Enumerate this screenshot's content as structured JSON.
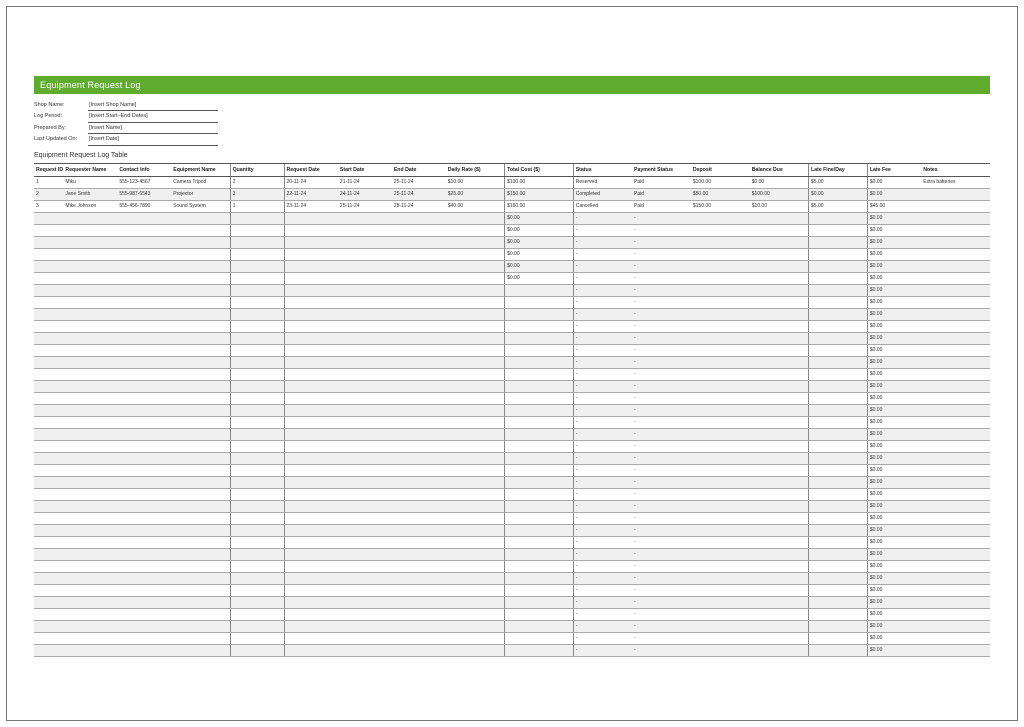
{
  "title": "Equipment Request Log",
  "meta": {
    "shop_name_label": "Shop Name:",
    "shop_name_value": "[Insert Shop Name]",
    "log_period_label": "Log Period:",
    "log_period_value": "[Insert Start–End Dates]",
    "prepared_by_label": "Prepared By:",
    "prepared_by_value": "[Insert Name]",
    "last_updated_label": "Last Updated On:",
    "last_updated_value": "[Insert Date]"
  },
  "subtitle": "Equipment Request Log Table",
  "columns": {
    "id": "Request ID",
    "requester": "Requester Name",
    "contact": "Contact Info",
    "equip": "Equipment Name",
    "qty": "Quantity",
    "rdate": "Request Date",
    "sdate": "Start Date",
    "edate": "End Date",
    "rate": "Daily Rate ($)",
    "total": "Total Cost ($)",
    "status": "Status",
    "paystat": "Payment Status",
    "deposit": "Deposit",
    "balance": "Balance Due",
    "lpd": "Late Fine/Day",
    "latefee": "Late Fee",
    "notes": "Notes"
  },
  "rows": [
    {
      "id": "1",
      "requester": "Miku",
      "contact": "555-123-4567",
      "equip": "Camera Tripod",
      "qty": "2",
      "rdate": "20-11-24",
      "sdate": "21-11-24",
      "edate": "25-11-24",
      "rate": "$10.00",
      "total": "$100.00",
      "status": "Reserved",
      "paystat": "Paid",
      "deposit": "$100.00",
      "balance": "$0.00",
      "lpd": "$5.00",
      "latefee": "$0.00",
      "notes": "Extra batteries"
    },
    {
      "id": "2",
      "requester": "Jane Smith",
      "contact": "555-987-6543",
      "equip": "Projector",
      "qty": "3",
      "rdate": "22-11-24",
      "sdate": "24-11-24",
      "edate": "25-11-24",
      "rate": "$25.00",
      "total": "$150.00",
      "status": "Completed",
      "paystat": "Paid",
      "deposit": "$50.00",
      "balance": "$100.00",
      "lpd": "$0.00",
      "latefee": "$0.00",
      "notes": ""
    },
    {
      "id": "3",
      "requester": "Mike Johnson",
      "contact": "555-456-7890",
      "equip": "Sound System",
      "qty": "1",
      "rdate": "23-11-24",
      "sdate": "25-11-24",
      "edate": "28-11-24",
      "rate": "$40.00",
      "total": "$160.00",
      "status": "Cancelled",
      "paystat": "Paid",
      "deposit": "$150.00",
      "balance": "$10.00",
      "lpd": "$5.00",
      "latefee": "$45.00",
      "notes": ""
    },
    {
      "id": "",
      "requester": "",
      "contact": "",
      "equip": "",
      "qty": "",
      "rdate": "",
      "sdate": "",
      "edate": "",
      "rate": "",
      "total": "$0.00",
      "status": "-",
      "paystat": "-",
      "deposit": "",
      "balance": "",
      "lpd": "",
      "latefee": "$0.00",
      "notes": ""
    },
    {
      "id": "",
      "requester": "",
      "contact": "",
      "equip": "",
      "qty": "",
      "rdate": "",
      "sdate": "",
      "edate": "",
      "rate": "",
      "total": "$0.00",
      "status": "-",
      "paystat": "-",
      "deposit": "",
      "balance": "",
      "lpd": "",
      "latefee": "$0.00",
      "notes": ""
    },
    {
      "id": "",
      "requester": "",
      "contact": "",
      "equip": "",
      "qty": "",
      "rdate": "",
      "sdate": "",
      "edate": "",
      "rate": "",
      "total": "$0.00",
      "status": "-",
      "paystat": "-",
      "deposit": "",
      "balance": "",
      "lpd": "",
      "latefee": "$0.00",
      "notes": ""
    },
    {
      "id": "",
      "requester": "",
      "contact": "",
      "equip": "",
      "qty": "",
      "rdate": "",
      "sdate": "",
      "edate": "",
      "rate": "",
      "total": "$0.00",
      "status": "-",
      "paystat": "-",
      "deposit": "",
      "balance": "",
      "lpd": "",
      "latefee": "$0.00",
      "notes": ""
    },
    {
      "id": "",
      "requester": "",
      "contact": "",
      "equip": "",
      "qty": "",
      "rdate": "",
      "sdate": "",
      "edate": "",
      "rate": "",
      "total": "$0.00",
      "status": "-",
      "paystat": "-",
      "deposit": "",
      "balance": "",
      "lpd": "",
      "latefee": "$0.00",
      "notes": ""
    },
    {
      "id": "",
      "requester": "",
      "contact": "",
      "equip": "",
      "qty": "",
      "rdate": "",
      "sdate": "",
      "edate": "",
      "rate": "",
      "total": "$0.00",
      "status": "-",
      "paystat": "-",
      "deposit": "",
      "balance": "",
      "lpd": "",
      "latefee": "$0.00",
      "notes": ""
    },
    {
      "id": "",
      "requester": "",
      "contact": "",
      "equip": "",
      "qty": "",
      "rdate": "",
      "sdate": "",
      "edate": "",
      "rate": "",
      "total": "",
      "status": "-",
      "paystat": "-",
      "deposit": "",
      "balance": "",
      "lpd": "",
      "latefee": "$0.00",
      "notes": ""
    },
    {
      "id": "",
      "requester": "",
      "contact": "",
      "equip": "",
      "qty": "",
      "rdate": "",
      "sdate": "",
      "edate": "",
      "rate": "",
      "total": "",
      "status": "-",
      "paystat": "-",
      "deposit": "",
      "balance": "",
      "lpd": "",
      "latefee": "$0.00",
      "notes": ""
    },
    {
      "id": "",
      "requester": "",
      "contact": "",
      "equip": "",
      "qty": "",
      "rdate": "",
      "sdate": "",
      "edate": "",
      "rate": "",
      "total": "",
      "status": "-",
      "paystat": "-",
      "deposit": "",
      "balance": "",
      "lpd": "",
      "latefee": "$0.00",
      "notes": ""
    },
    {
      "id": "",
      "requester": "",
      "contact": "",
      "equip": "",
      "qty": "",
      "rdate": "",
      "sdate": "",
      "edate": "",
      "rate": "",
      "total": "",
      "status": "-",
      "paystat": "-",
      "deposit": "",
      "balance": "",
      "lpd": "",
      "latefee": "$0.00",
      "notes": ""
    },
    {
      "id": "",
      "requester": "",
      "contact": "",
      "equip": "",
      "qty": "",
      "rdate": "",
      "sdate": "",
      "edate": "",
      "rate": "",
      "total": "",
      "status": "-",
      "paystat": "-",
      "deposit": "",
      "balance": "",
      "lpd": "",
      "latefee": "$0.00",
      "notes": ""
    },
    {
      "id": "",
      "requester": "",
      "contact": "",
      "equip": "",
      "qty": "",
      "rdate": "",
      "sdate": "",
      "edate": "",
      "rate": "",
      "total": "",
      "status": "-",
      "paystat": "-",
      "deposit": "",
      "balance": "",
      "lpd": "",
      "latefee": "$0.00",
      "notes": ""
    },
    {
      "id": "",
      "requester": "",
      "contact": "",
      "equip": "",
      "qty": "",
      "rdate": "",
      "sdate": "",
      "edate": "",
      "rate": "",
      "total": "",
      "status": "-",
      "paystat": "-",
      "deposit": "",
      "balance": "",
      "lpd": "",
      "latefee": "$0.00",
      "notes": ""
    },
    {
      "id": "",
      "requester": "",
      "contact": "",
      "equip": "",
      "qty": "",
      "rdate": "",
      "sdate": "",
      "edate": "",
      "rate": "",
      "total": "",
      "status": "-",
      "paystat": "-",
      "deposit": "",
      "balance": "",
      "lpd": "",
      "latefee": "$0.00",
      "notes": ""
    },
    {
      "id": "",
      "requester": "",
      "contact": "",
      "equip": "",
      "qty": "",
      "rdate": "",
      "sdate": "",
      "edate": "",
      "rate": "",
      "total": "",
      "status": "-",
      "paystat": "-",
      "deposit": "",
      "balance": "",
      "lpd": "",
      "latefee": "$0.00",
      "notes": ""
    },
    {
      "id": "",
      "requester": "",
      "contact": "",
      "equip": "",
      "qty": "",
      "rdate": "",
      "sdate": "",
      "edate": "",
      "rate": "",
      "total": "",
      "status": "-",
      "paystat": "-",
      "deposit": "",
      "balance": "",
      "lpd": "",
      "latefee": "$0.00",
      "notes": ""
    },
    {
      "id": "",
      "requester": "",
      "contact": "",
      "equip": "",
      "qty": "",
      "rdate": "",
      "sdate": "",
      "edate": "",
      "rate": "",
      "total": "",
      "status": "-",
      "paystat": "-",
      "deposit": "",
      "balance": "",
      "lpd": "",
      "latefee": "$0.00",
      "notes": ""
    },
    {
      "id": "",
      "requester": "",
      "contact": "",
      "equip": "",
      "qty": "",
      "rdate": "",
      "sdate": "",
      "edate": "",
      "rate": "",
      "total": "",
      "status": "-",
      "paystat": "-",
      "deposit": "",
      "balance": "",
      "lpd": "",
      "latefee": "$0.00",
      "notes": ""
    },
    {
      "id": "",
      "requester": "",
      "contact": "",
      "equip": "",
      "qty": "",
      "rdate": "",
      "sdate": "",
      "edate": "",
      "rate": "",
      "total": "",
      "status": "-",
      "paystat": "-",
      "deposit": "",
      "balance": "",
      "lpd": "",
      "latefee": "$0.00",
      "notes": ""
    },
    {
      "id": "",
      "requester": "",
      "contact": "",
      "equip": "",
      "qty": "",
      "rdate": "",
      "sdate": "",
      "edate": "",
      "rate": "",
      "total": "",
      "status": "-",
      "paystat": "-",
      "deposit": "",
      "balance": "",
      "lpd": "",
      "latefee": "$0.00",
      "notes": ""
    },
    {
      "id": "",
      "requester": "",
      "contact": "",
      "equip": "",
      "qty": "",
      "rdate": "",
      "sdate": "",
      "edate": "",
      "rate": "",
      "total": "",
      "status": "-",
      "paystat": "-",
      "deposit": "",
      "balance": "",
      "lpd": "",
      "latefee": "$0.00",
      "notes": ""
    },
    {
      "id": "",
      "requester": "",
      "contact": "",
      "equip": "",
      "qty": "",
      "rdate": "",
      "sdate": "",
      "edate": "",
      "rate": "",
      "total": "",
      "status": "-",
      "paystat": "-",
      "deposit": "",
      "balance": "",
      "lpd": "",
      "latefee": "$0.00",
      "notes": ""
    },
    {
      "id": "",
      "requester": "",
      "contact": "",
      "equip": "",
      "qty": "",
      "rdate": "",
      "sdate": "",
      "edate": "",
      "rate": "",
      "total": "",
      "status": "-",
      "paystat": "-",
      "deposit": "",
      "balance": "",
      "lpd": "",
      "latefee": "$0.00",
      "notes": ""
    },
    {
      "id": "",
      "requester": "",
      "contact": "",
      "equip": "",
      "qty": "",
      "rdate": "",
      "sdate": "",
      "edate": "",
      "rate": "",
      "total": "",
      "status": "-",
      "paystat": "-",
      "deposit": "",
      "balance": "",
      "lpd": "",
      "latefee": "$0.00",
      "notes": ""
    },
    {
      "id": "",
      "requester": "",
      "contact": "",
      "equip": "",
      "qty": "",
      "rdate": "",
      "sdate": "",
      "edate": "",
      "rate": "",
      "total": "",
      "status": "-",
      "paystat": "-",
      "deposit": "",
      "balance": "",
      "lpd": "",
      "latefee": "$0.00",
      "notes": ""
    },
    {
      "id": "",
      "requester": "",
      "contact": "",
      "equip": "",
      "qty": "",
      "rdate": "",
      "sdate": "",
      "edate": "",
      "rate": "",
      "total": "",
      "status": "-",
      "paystat": "-",
      "deposit": "",
      "balance": "",
      "lpd": "",
      "latefee": "$0.00",
      "notes": ""
    },
    {
      "id": "",
      "requester": "",
      "contact": "",
      "equip": "",
      "qty": "",
      "rdate": "",
      "sdate": "",
      "edate": "",
      "rate": "",
      "total": "",
      "status": "-",
      "paystat": "-",
      "deposit": "",
      "balance": "",
      "lpd": "",
      "latefee": "$0.00",
      "notes": ""
    },
    {
      "id": "",
      "requester": "",
      "contact": "",
      "equip": "",
      "qty": "",
      "rdate": "",
      "sdate": "",
      "edate": "",
      "rate": "",
      "total": "",
      "status": "-",
      "paystat": "-",
      "deposit": "",
      "balance": "",
      "lpd": "",
      "latefee": "$0.00",
      "notes": ""
    },
    {
      "id": "",
      "requester": "",
      "contact": "",
      "equip": "",
      "qty": "",
      "rdate": "",
      "sdate": "",
      "edate": "",
      "rate": "",
      "total": "",
      "status": "-",
      "paystat": "-",
      "deposit": "",
      "balance": "",
      "lpd": "",
      "latefee": "$0.00",
      "notes": ""
    },
    {
      "id": "",
      "requester": "",
      "contact": "",
      "equip": "",
      "qty": "",
      "rdate": "",
      "sdate": "",
      "edate": "",
      "rate": "",
      "total": "",
      "status": "-",
      "paystat": "-",
      "deposit": "",
      "balance": "",
      "lpd": "",
      "latefee": "$0.00",
      "notes": ""
    },
    {
      "id": "",
      "requester": "",
      "contact": "",
      "equip": "",
      "qty": "",
      "rdate": "",
      "sdate": "",
      "edate": "",
      "rate": "",
      "total": "",
      "status": "-",
      "paystat": "-",
      "deposit": "",
      "balance": "",
      "lpd": "",
      "latefee": "$0.00",
      "notes": ""
    },
    {
      "id": "",
      "requester": "",
      "contact": "",
      "equip": "",
      "qty": "",
      "rdate": "",
      "sdate": "",
      "edate": "",
      "rate": "",
      "total": "",
      "status": "-",
      "paystat": "-",
      "deposit": "",
      "balance": "",
      "lpd": "",
      "latefee": "$0.00",
      "notes": ""
    },
    {
      "id": "",
      "requester": "",
      "contact": "",
      "equip": "",
      "qty": "",
      "rdate": "",
      "sdate": "",
      "edate": "",
      "rate": "",
      "total": "",
      "status": "-",
      "paystat": "-",
      "deposit": "",
      "balance": "",
      "lpd": "",
      "latefee": "$0.00",
      "notes": ""
    },
    {
      "id": "",
      "requester": "",
      "contact": "",
      "equip": "",
      "qty": "",
      "rdate": "",
      "sdate": "",
      "edate": "",
      "rate": "",
      "total": "",
      "status": "-",
      "paystat": "-",
      "deposit": "",
      "balance": "",
      "lpd": "",
      "latefee": "$0.00",
      "notes": ""
    },
    {
      "id": "",
      "requester": "",
      "contact": "",
      "equip": "",
      "qty": "",
      "rdate": "",
      "sdate": "",
      "edate": "",
      "rate": "",
      "total": "",
      "status": "-",
      "paystat": "-",
      "deposit": "",
      "balance": "",
      "lpd": "",
      "latefee": "$0.00",
      "notes": ""
    },
    {
      "id": "",
      "requester": "",
      "contact": "",
      "equip": "",
      "qty": "",
      "rdate": "",
      "sdate": "",
      "edate": "",
      "rate": "",
      "total": "",
      "status": "-",
      "paystat": "-",
      "deposit": "",
      "balance": "",
      "lpd": "",
      "latefee": "$0.00",
      "notes": ""
    },
    {
      "id": "",
      "requester": "",
      "contact": "",
      "equip": "",
      "qty": "",
      "rdate": "",
      "sdate": "",
      "edate": "",
      "rate": "",
      "total": "",
      "status": "-",
      "paystat": "-",
      "deposit": "",
      "balance": "",
      "lpd": "",
      "latefee": "$0.00",
      "notes": ""
    }
  ]
}
